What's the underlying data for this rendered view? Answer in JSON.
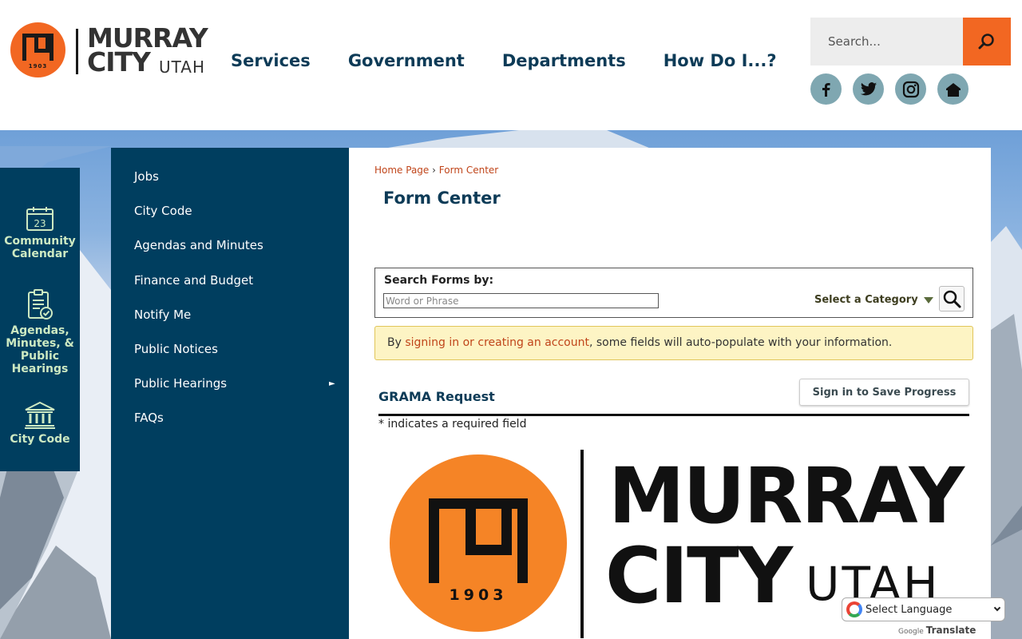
{
  "header": {
    "logo": {
      "murray": "MURRAY",
      "city": "CITY",
      "utah": "UTAH",
      "year": "1903"
    },
    "nav": [
      "Services",
      "Government",
      "Departments",
      "How Do I...?"
    ],
    "search": {
      "placeholder": "Search..."
    },
    "social": [
      "facebook-icon",
      "twitter-icon",
      "instagram-icon",
      "home-icon"
    ],
    "accent_color": "#f26722",
    "nav_color": "#0d3b57"
  },
  "quick_links": [
    {
      "label": "Community Calendar",
      "icon": "calendar-icon",
      "day": "23"
    },
    {
      "label": "Agendas, Minutes, & Public Hearings",
      "icon": "clipboard-check-icon"
    },
    {
      "label": "City Code",
      "icon": "courthouse-icon"
    }
  ],
  "side_menu": {
    "items": [
      "Jobs",
      "City Code",
      "Agendas and Minutes",
      "Finance and Budget",
      "Notify Me",
      "Public Notices",
      "Public Hearings",
      "FAQs"
    ],
    "expand_arrow": "►"
  },
  "content": {
    "breadcrumb": {
      "home": "Home Page",
      "separator": "›",
      "current": "Form Center"
    },
    "title": "Form Center",
    "search_forms": {
      "label": "Search Forms by:",
      "placeholder": "Word or Phrase",
      "category": "Select a Category"
    },
    "notice": {
      "prefix": "By ",
      "link": "signing in or creating an account",
      "suffix": ", some fields will auto-populate with your information."
    },
    "form": {
      "title": "GRAMA Request",
      "save_button": "Sign in to Save Progress",
      "required_note": "* indicates a required field"
    },
    "form_logo": {
      "murray": "MURRAY",
      "city": "CITY",
      "utah": "UTAH",
      "year": "1903"
    }
  },
  "translate": {
    "select_label": "Select Language",
    "powered_google": "Google",
    "powered_translate": "Translate"
  }
}
